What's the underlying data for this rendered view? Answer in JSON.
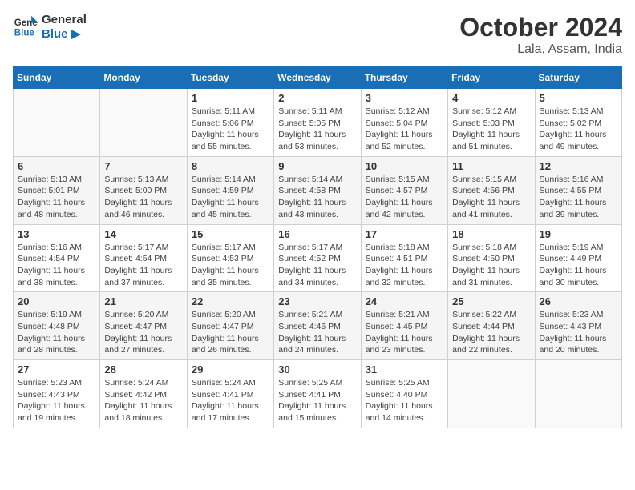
{
  "header": {
    "logo_line1": "General",
    "logo_line2": "Blue",
    "title": "October 2024",
    "location": "Lala, Assam, India"
  },
  "columns": [
    "Sunday",
    "Monday",
    "Tuesday",
    "Wednesday",
    "Thursday",
    "Friday",
    "Saturday"
  ],
  "weeks": [
    [
      {
        "day": "",
        "info": ""
      },
      {
        "day": "",
        "info": ""
      },
      {
        "day": "1",
        "info": "Sunrise: 5:11 AM\nSunset: 5:06 PM\nDaylight: 11 hours and 55 minutes."
      },
      {
        "day": "2",
        "info": "Sunrise: 5:11 AM\nSunset: 5:05 PM\nDaylight: 11 hours and 53 minutes."
      },
      {
        "day": "3",
        "info": "Sunrise: 5:12 AM\nSunset: 5:04 PM\nDaylight: 11 hours and 52 minutes."
      },
      {
        "day": "4",
        "info": "Sunrise: 5:12 AM\nSunset: 5:03 PM\nDaylight: 11 hours and 51 minutes."
      },
      {
        "day": "5",
        "info": "Sunrise: 5:13 AM\nSunset: 5:02 PM\nDaylight: 11 hours and 49 minutes."
      }
    ],
    [
      {
        "day": "6",
        "info": "Sunrise: 5:13 AM\nSunset: 5:01 PM\nDaylight: 11 hours and 48 minutes."
      },
      {
        "day": "7",
        "info": "Sunrise: 5:13 AM\nSunset: 5:00 PM\nDaylight: 11 hours and 46 minutes."
      },
      {
        "day": "8",
        "info": "Sunrise: 5:14 AM\nSunset: 4:59 PM\nDaylight: 11 hours and 45 minutes."
      },
      {
        "day": "9",
        "info": "Sunrise: 5:14 AM\nSunset: 4:58 PM\nDaylight: 11 hours and 43 minutes."
      },
      {
        "day": "10",
        "info": "Sunrise: 5:15 AM\nSunset: 4:57 PM\nDaylight: 11 hours and 42 minutes."
      },
      {
        "day": "11",
        "info": "Sunrise: 5:15 AM\nSunset: 4:56 PM\nDaylight: 11 hours and 41 minutes."
      },
      {
        "day": "12",
        "info": "Sunrise: 5:16 AM\nSunset: 4:55 PM\nDaylight: 11 hours and 39 minutes."
      }
    ],
    [
      {
        "day": "13",
        "info": "Sunrise: 5:16 AM\nSunset: 4:54 PM\nDaylight: 11 hours and 38 minutes."
      },
      {
        "day": "14",
        "info": "Sunrise: 5:17 AM\nSunset: 4:54 PM\nDaylight: 11 hours and 37 minutes."
      },
      {
        "day": "15",
        "info": "Sunrise: 5:17 AM\nSunset: 4:53 PM\nDaylight: 11 hours and 35 minutes."
      },
      {
        "day": "16",
        "info": "Sunrise: 5:17 AM\nSunset: 4:52 PM\nDaylight: 11 hours and 34 minutes."
      },
      {
        "day": "17",
        "info": "Sunrise: 5:18 AM\nSunset: 4:51 PM\nDaylight: 11 hours and 32 minutes."
      },
      {
        "day": "18",
        "info": "Sunrise: 5:18 AM\nSunset: 4:50 PM\nDaylight: 11 hours and 31 minutes."
      },
      {
        "day": "19",
        "info": "Sunrise: 5:19 AM\nSunset: 4:49 PM\nDaylight: 11 hours and 30 minutes."
      }
    ],
    [
      {
        "day": "20",
        "info": "Sunrise: 5:19 AM\nSunset: 4:48 PM\nDaylight: 11 hours and 28 minutes."
      },
      {
        "day": "21",
        "info": "Sunrise: 5:20 AM\nSunset: 4:47 PM\nDaylight: 11 hours and 27 minutes."
      },
      {
        "day": "22",
        "info": "Sunrise: 5:20 AM\nSunset: 4:47 PM\nDaylight: 11 hours and 26 minutes."
      },
      {
        "day": "23",
        "info": "Sunrise: 5:21 AM\nSunset: 4:46 PM\nDaylight: 11 hours and 24 minutes."
      },
      {
        "day": "24",
        "info": "Sunrise: 5:21 AM\nSunset: 4:45 PM\nDaylight: 11 hours and 23 minutes."
      },
      {
        "day": "25",
        "info": "Sunrise: 5:22 AM\nSunset: 4:44 PM\nDaylight: 11 hours and 22 minutes."
      },
      {
        "day": "26",
        "info": "Sunrise: 5:23 AM\nSunset: 4:43 PM\nDaylight: 11 hours and 20 minutes."
      }
    ],
    [
      {
        "day": "27",
        "info": "Sunrise: 5:23 AM\nSunset: 4:43 PM\nDaylight: 11 hours and 19 minutes."
      },
      {
        "day": "28",
        "info": "Sunrise: 5:24 AM\nSunset: 4:42 PM\nDaylight: 11 hours and 18 minutes."
      },
      {
        "day": "29",
        "info": "Sunrise: 5:24 AM\nSunset: 4:41 PM\nDaylight: 11 hours and 17 minutes."
      },
      {
        "day": "30",
        "info": "Sunrise: 5:25 AM\nSunset: 4:41 PM\nDaylight: 11 hours and 15 minutes."
      },
      {
        "day": "31",
        "info": "Sunrise: 5:25 AM\nSunset: 4:40 PM\nDaylight: 11 hours and 14 minutes."
      },
      {
        "day": "",
        "info": ""
      },
      {
        "day": "",
        "info": ""
      }
    ]
  ]
}
